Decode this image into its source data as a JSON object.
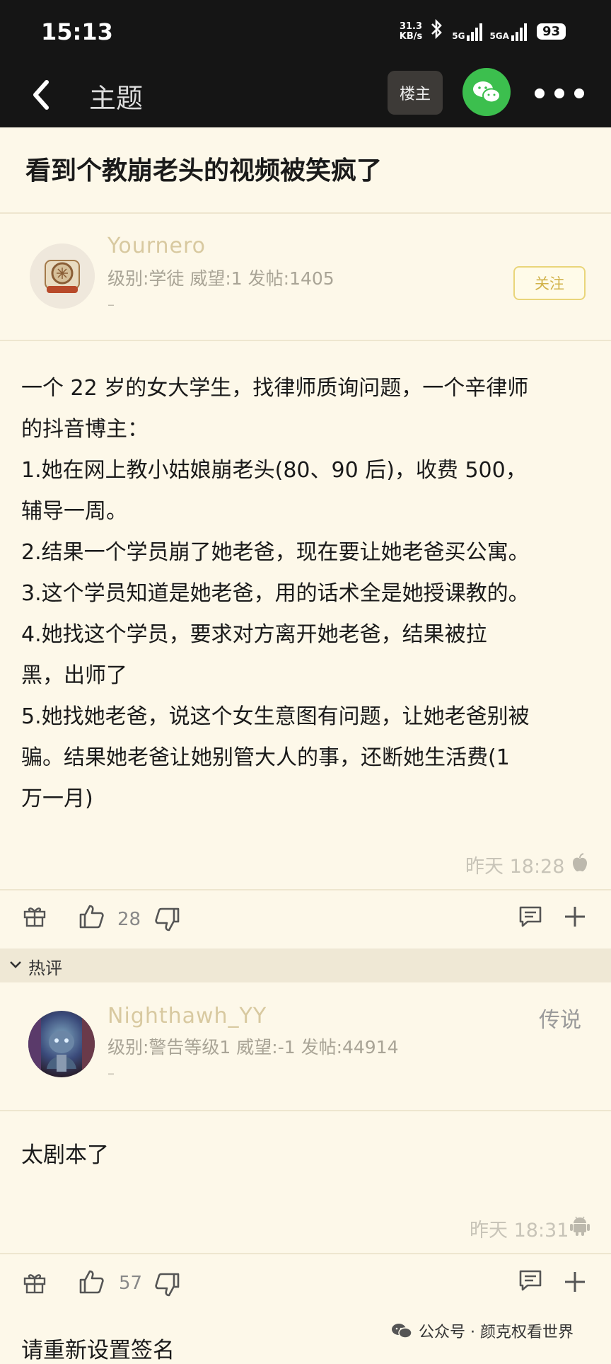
{
  "status": {
    "time": "15:13",
    "net_speed_value": "31.3",
    "net_speed_unit": "KB/s",
    "signal1": "5G",
    "signal2": "5GA",
    "battery": "93"
  },
  "nav": {
    "title": "主题",
    "owner_label": "楼主",
    "icons": [
      "back-icon",
      "wechat-icon",
      "more-icon"
    ]
  },
  "thread": {
    "title": "看到个教崩老头的视频被笑疯了"
  },
  "post": {
    "username": "Yournero",
    "meta": "级别:学徒 威望:1 发帖:1405",
    "signature_dash": "–",
    "follow_label": "关注",
    "body": "一个 22 岁的女大学生，找律师质询问题，一个辛律师\n的抖音博主：\n1.她在网上教小姑娘崩老头(80、90 后)，收费 500，\n辅导一周。\n2.结果一个学员崩了她老爸，现在要让她老爸买公寓。\n3.这个学员知道是她老爸，用的话术全是她授课教的。\n4.她找这个学员，要求对方离开她老爸，结果被拉\n黑，出师了\n5.她找她老爸，说这个女生意图有问题，让她老爸别被\n骗。结果她老爸让她别管大人的事，还断她生活费(1\n万一月)",
    "timestamp": "昨天 18:28",
    "device_icon": "apple-icon",
    "likes": "28"
  },
  "hot_section": {
    "label": "热评"
  },
  "reply": {
    "username": "Nighthawh_YY",
    "meta": "级别:警告等级1 威望:-1 发帖:44914",
    "signature_dash": "–",
    "rank": "传说",
    "body": "太剧本了",
    "timestamp": "昨天 18:31",
    "device_icon": "android-icon",
    "likes": "57"
  },
  "footer": {
    "signature_prompt": "请重新设置签名",
    "watermark": "公众号 · 颜克权看世界"
  },
  "colors": {
    "background": "#fdf8e9",
    "header": "#151515",
    "username": "#d8c9a0",
    "wechat_green": "#3cbf4e",
    "follow_border": "#e9d57a"
  }
}
